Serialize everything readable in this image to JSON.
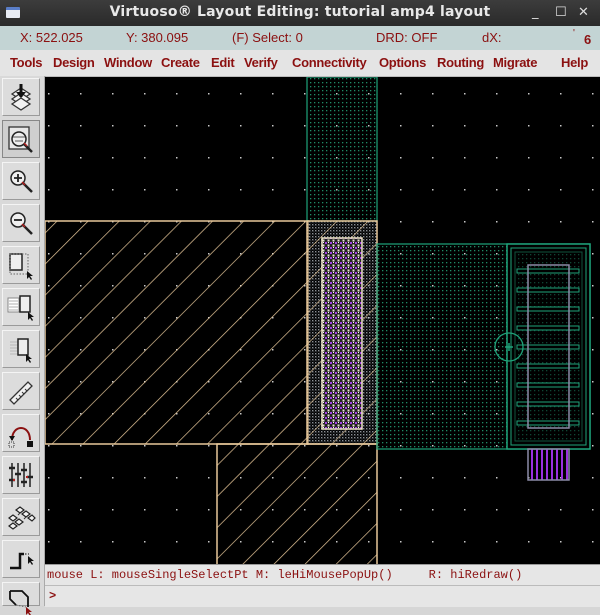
{
  "window": {
    "title": "Virtuoso® Layout Editing: tutorial amp4 layout",
    "minimize": "_",
    "maximize": "☐",
    "close": "✕"
  },
  "status": {
    "x": "X:  522.025",
    "y": "Y:  380.095",
    "select": "(F) Select: 0",
    "drd": "DRD: OFF",
    "dx": "dX:",
    "tick": "'",
    "count": "6"
  },
  "menu": {
    "items": [
      "Tools",
      "Design",
      "Window",
      "Create",
      "Edit",
      "Verify",
      "Connectivity",
      "Options",
      "Routing",
      "Migrate",
      "Help"
    ]
  },
  "toolbar": {
    "tools": [
      {
        "name": "save-icon"
      },
      {
        "name": "fit-view-icon"
      },
      {
        "name": "zoom-in-icon"
      },
      {
        "name": "zoom-out-icon"
      },
      {
        "name": "stretch-icon"
      },
      {
        "name": "copy-icon"
      },
      {
        "name": "move-icon"
      },
      {
        "name": "ruler-icon"
      },
      {
        "name": "undo-arc-icon"
      },
      {
        "name": "properties-icon"
      },
      {
        "name": "create-instance-icon"
      },
      {
        "name": "create-path-icon"
      },
      {
        "name": "create-polygon-icon"
      }
    ]
  },
  "colors": {
    "accent_text": "#8b1010",
    "poly": "#e8c89a",
    "metal_green": "#1fa37a",
    "via_purple": "#a040e0",
    "grid_dot": "#c8c8c8"
  },
  "message_line": {
    "text": "mouse L: mouseSingleSelectPt M: leHiMousePopUp()     R: hiRedraw()"
  },
  "command_line": {
    "prompt": ">"
  }
}
